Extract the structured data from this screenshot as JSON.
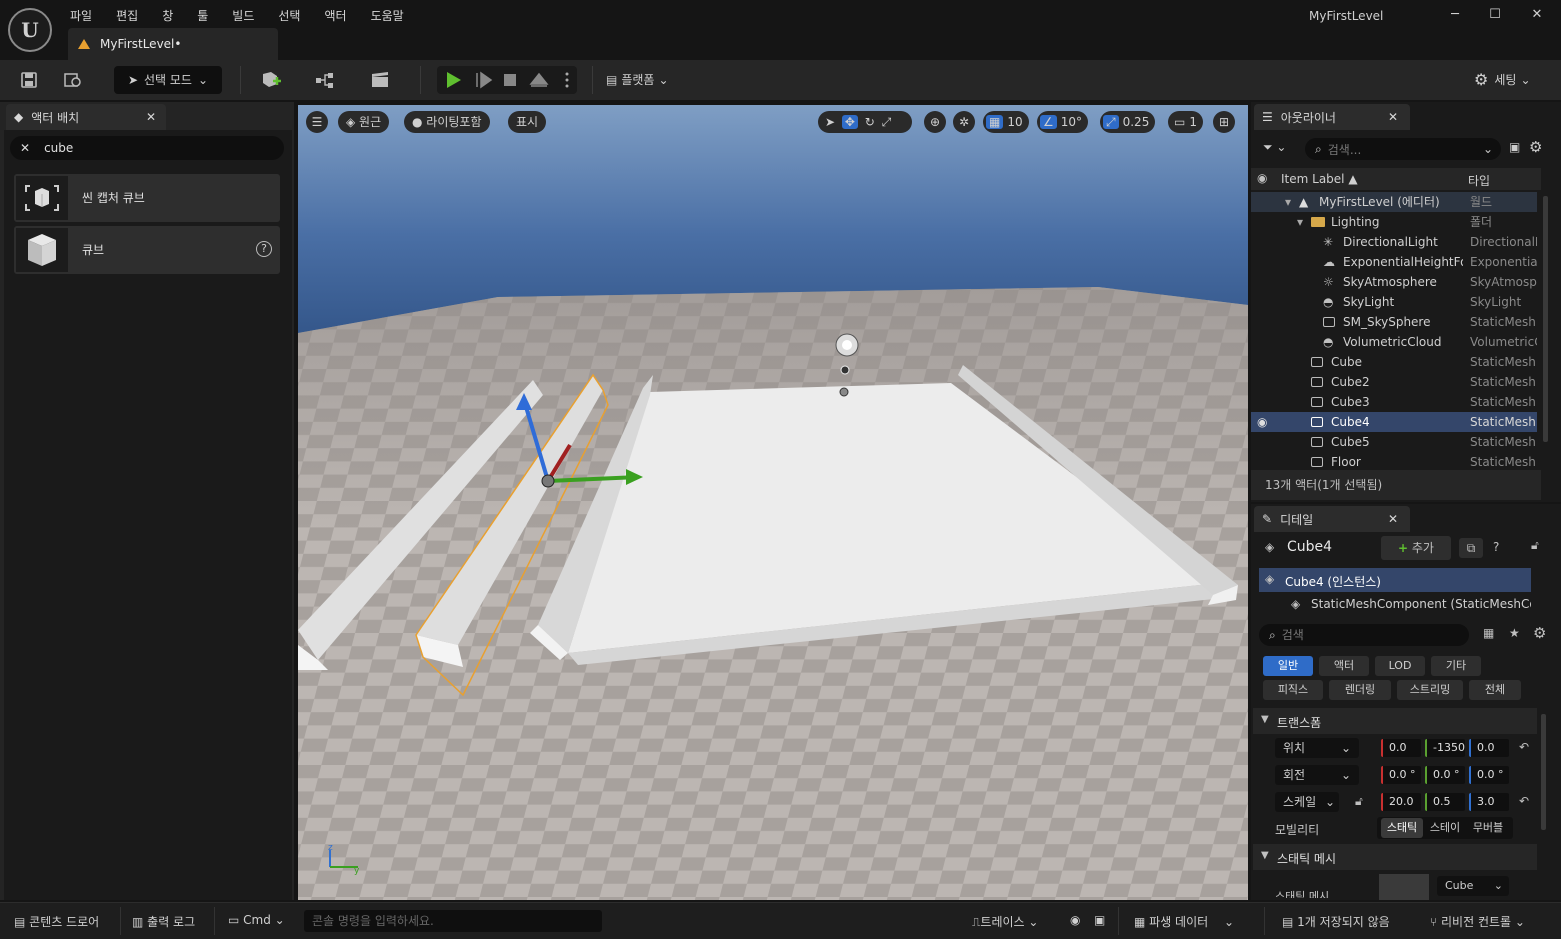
{
  "window": {
    "title": "MyFirstLevel",
    "tab": "MyFirstLevel•",
    "minimize": "─",
    "maximize": "☐",
    "close": "✕"
  },
  "menu": [
    "파일",
    "편집",
    "창",
    "툴",
    "빌드",
    "선택",
    "액터",
    "도움말"
  ],
  "toolbar": {
    "mode_label": "선택 모드",
    "platform_label": "플랫폼",
    "settings_label": "세팅"
  },
  "place_actors": {
    "tab_label": "액터 배치",
    "search_value": "cube",
    "items": [
      {
        "label": "씬 캡처 큐브"
      },
      {
        "label": "큐브"
      }
    ]
  },
  "viewport": {
    "perspective": "원근",
    "lit": "라이팅포함",
    "show": "표시",
    "grid_snap": "10",
    "rot_snap": "10°",
    "scale_snap": "0.25",
    "camera_speed": "1"
  },
  "outliner": {
    "tab_label": "아웃라이너",
    "search_placeholder": "검색...",
    "col_label": "Item Label ▲",
    "col_type": "타입",
    "rows": [
      {
        "name": "MyFirstLevel (에디터)",
        "type": "월드"
      },
      {
        "name": "Lighting",
        "type": "폴더"
      },
      {
        "name": "DirectionalLight",
        "type": "DirectionalL"
      },
      {
        "name": "ExponentialHeightFo",
        "type": "Exponential"
      },
      {
        "name": "SkyAtmosphere",
        "type": "SkyAtmosp"
      },
      {
        "name": "SkyLight",
        "type": "SkyLight"
      },
      {
        "name": "SM_SkySphere",
        "type": "StaticMesh."
      },
      {
        "name": "VolumetricCloud",
        "type": "VolumetricC"
      },
      {
        "name": "Cube",
        "type": "StaticMesh."
      },
      {
        "name": "Cube2",
        "type": "StaticMesh."
      },
      {
        "name": "Cube3",
        "type": "StaticMesh."
      },
      {
        "name": "Cube4",
        "type": "StaticMesh."
      },
      {
        "name": "Cube5",
        "type": "StaticMesh."
      },
      {
        "name": "Floor",
        "type": "StaticMesh."
      }
    ],
    "footer": "13개 액터(1개 선택됨)"
  },
  "details": {
    "tab_label": "디테일",
    "actor_name": "Cube4",
    "add_label": "추가",
    "components": [
      "Cube4 (인스턴스)",
      "StaticMeshComponent (StaticMeshCo"
    ],
    "search_placeholder": "검색",
    "filters_row1": [
      "일반",
      "액터",
      "LOD",
      "기타"
    ],
    "filters_row2": [
      "피직스",
      "렌더링",
      "스트리밍",
      "전체"
    ],
    "transform_header": "트랜스폼",
    "location_label": "위치",
    "rotation_label": "회전",
    "scale_label": "스케일",
    "location": [
      "0.0",
      "-1350",
      "0.0"
    ],
    "rotation": [
      "0.0 °",
      "0.0 °",
      "0.0 °"
    ],
    "scale": [
      "20.0",
      "0.5",
      "3.0"
    ],
    "mobility_label": "모빌리티",
    "mobility_options": [
      "스태틱",
      "스테이",
      "무버블"
    ],
    "static_mesh_header": "스태틱 메시",
    "static_mesh_label": "스태틱 메시",
    "static_mesh_value": "Cube"
  },
  "statusbar": {
    "content_drawer": "콘텐츠 드로어",
    "output_log": "출력 로그",
    "cmd": "Cmd",
    "console_placeholder": "콘솔 명령을 입력하세요.",
    "trace": "트레이스",
    "derived_data": "파생 데이터",
    "unsaved": "1개 저장되지 않음",
    "revision_control": "리비전 컨트롤"
  },
  "colors": {
    "accent_blue": "#2f6cc8",
    "selection_orange": "#e8a030",
    "play_green": "#5fbf2f"
  }
}
